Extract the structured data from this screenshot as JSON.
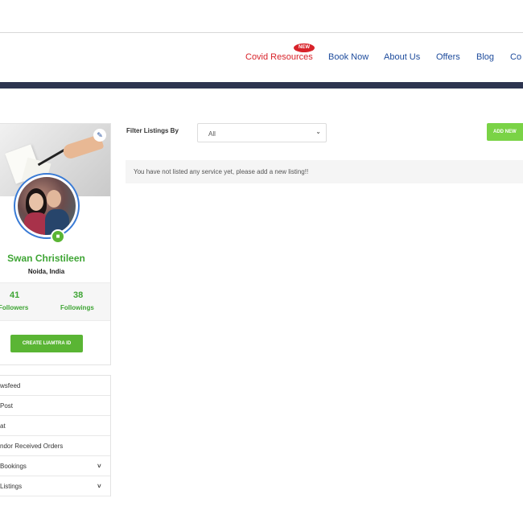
{
  "nav": {
    "items": [
      {
        "label": "Covid Resources",
        "color": "#d8232a"
      },
      {
        "label": "Book Now"
      },
      {
        "label": "About Us"
      },
      {
        "label": "Offers"
      },
      {
        "label": "Blog"
      },
      {
        "label": "Co"
      }
    ],
    "new_badge": "NEW",
    "link_color": "#1d4b9c",
    "bar_color": "#2d3550"
  },
  "profile": {
    "name": "Swan Christileen",
    "location": "Noida, India",
    "stats": [
      {
        "value": "41",
        "label": "Followers"
      },
      {
        "value": "38",
        "label": "Followings"
      }
    ],
    "create_button": "CREATE LIAMTRA ID",
    "accent_color": "#3fa535",
    "edit_icon": "edit-icon",
    "camera_icon": "camera-icon"
  },
  "menu": {
    "items": [
      {
        "label": "wsfeed",
        "has_dropdown": false
      },
      {
        "label": "Post",
        "has_dropdown": false
      },
      {
        "label": "at",
        "has_dropdown": false
      },
      {
        "label": "ndor Received Orders",
        "has_dropdown": false
      },
      {
        "label": "Bookings",
        "has_dropdown": true
      },
      {
        "label": "Listings",
        "has_dropdown": true
      }
    ],
    "chevron": "˅"
  },
  "main": {
    "filter_label": "Filter Listings By",
    "filter_value": "All",
    "select_arrow": "⌄",
    "add_button": "ADD NEW",
    "empty_message": "You have not listed any service yet, please add a new listing!!"
  }
}
